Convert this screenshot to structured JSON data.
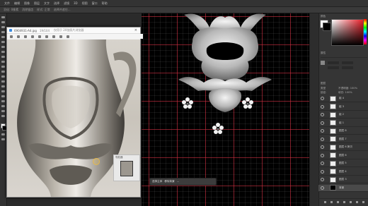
{
  "menu": {
    "items": [
      "文件",
      "编辑",
      "图像",
      "图层",
      "文字",
      "选择",
      "滤镜",
      "3D",
      "视图",
      "窗口",
      "帮助"
    ]
  },
  "options_bar": {
    "items": [
      "羽化: 0像素",
      "消除锯齿",
      "样式: 正常",
      "选择并遮住..."
    ]
  },
  "photo_viewer": {
    "title": "6904931-A4.jpg",
    "zoom": "19/104",
    "subtitle": "仅用于 20张照片浏览器",
    "navigator_label": "导航器"
  },
  "canvas": {
    "colors": {
      "background": "#000000",
      "grid": "#dc283c"
    }
  },
  "context_bar": {
    "items": [
      "选择主体",
      "移除背景",
      "⋯"
    ]
  },
  "right_panel": {
    "color_title": "颜色",
    "properties_title": "属性",
    "layers_title": "图层",
    "search_label": "类型",
    "opacity_label": "不透明度: 100%",
    "fill_label": "填充: 100%",
    "lock_label": "锁定:",
    "layers": [
      "组 4",
      "组 3",
      "组 2",
      "组 1",
      "图层 8",
      "图层 7",
      "图层 6 拷贝",
      "图层 6",
      "图层 5",
      "图层 4",
      "图层 3",
      "背景"
    ],
    "selected_layer_index": 11
  }
}
